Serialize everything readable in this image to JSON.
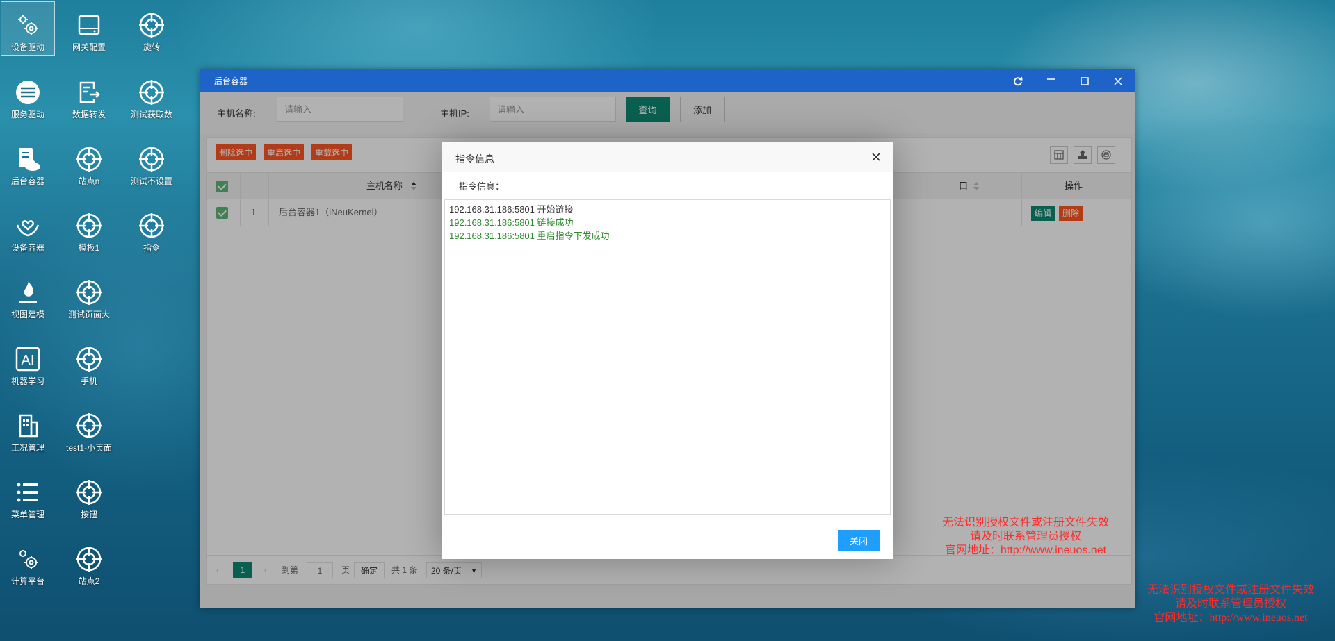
{
  "desktop": {
    "icons": [
      {
        "label": "设备驱动"
      },
      {
        "label": "网关配置"
      },
      {
        "label": "旋转"
      },
      {
        "label": "服务驱动"
      },
      {
        "label": "数据转发"
      },
      {
        "label": "测试获取数"
      },
      {
        "label": "后台容器"
      },
      {
        "label": "站点n"
      },
      {
        "label": "测试不设置"
      },
      {
        "label": "设备容器"
      },
      {
        "label": "模板1"
      },
      {
        "label": "指令"
      },
      {
        "label": "视图建模"
      },
      {
        "label": "测试页面大"
      },
      {
        "label": "机器学习"
      },
      {
        "label": "手机"
      },
      {
        "label": "工况管理"
      },
      {
        "label": "test1-小页面"
      },
      {
        "label": "菜单管理"
      },
      {
        "label": "按钮"
      },
      {
        "label": "计算平台"
      },
      {
        "label": "站点2"
      }
    ]
  },
  "window": {
    "title": "后台容器",
    "filter": {
      "host_name_label": "主机名称:",
      "host_name_placeholder": "请输入",
      "host_ip_label": "主机IP:",
      "host_ip_placeholder": "请输入",
      "query_button": "查询",
      "add_button": "添加"
    },
    "toolbar": {
      "delete_selected": "删除选中",
      "restart_selected": "重启选中",
      "reload_selected": "重载选中"
    },
    "table": {
      "col_host_name": "主机名称",
      "col_port_partial": "口",
      "col_actions": "操作",
      "rows": [
        {
          "index": "1",
          "host_name": "后台容器1（iNeuKernel）",
          "edit": "编辑",
          "delete": "删除"
        }
      ]
    },
    "pager": {
      "current_page": "1",
      "goto_label": "到第",
      "goto_value": "1",
      "page_unit": "页",
      "confirm": "确定",
      "total": "共 1 条",
      "page_size": "20 条/页"
    }
  },
  "dialog": {
    "title": "指令信息",
    "sub_label": "指令信息：",
    "lines": [
      {
        "text": "192.168.31.186:5801 开始链接"
      },
      {
        "text": "192.168.31.186:5801 链接成功"
      },
      {
        "text": "192.168.31.186:5801 重启指令下发成功"
      }
    ],
    "close_button": "关闭"
  },
  "warnings": {
    "line1": "无法识别授权文件或注册文件失效",
    "line2": "请及时联系管理员授权",
    "line3": "官网地址：http://www.ineuos.net"
  },
  "colors": {
    "title_bar": "#1e64c8",
    "primary_green": "#0f8a73",
    "danger_orange": "#ff5722",
    "dialog_button": "#1e9fff",
    "log_success": "#2e8b2e",
    "warning_red": "#ff2a2a"
  }
}
